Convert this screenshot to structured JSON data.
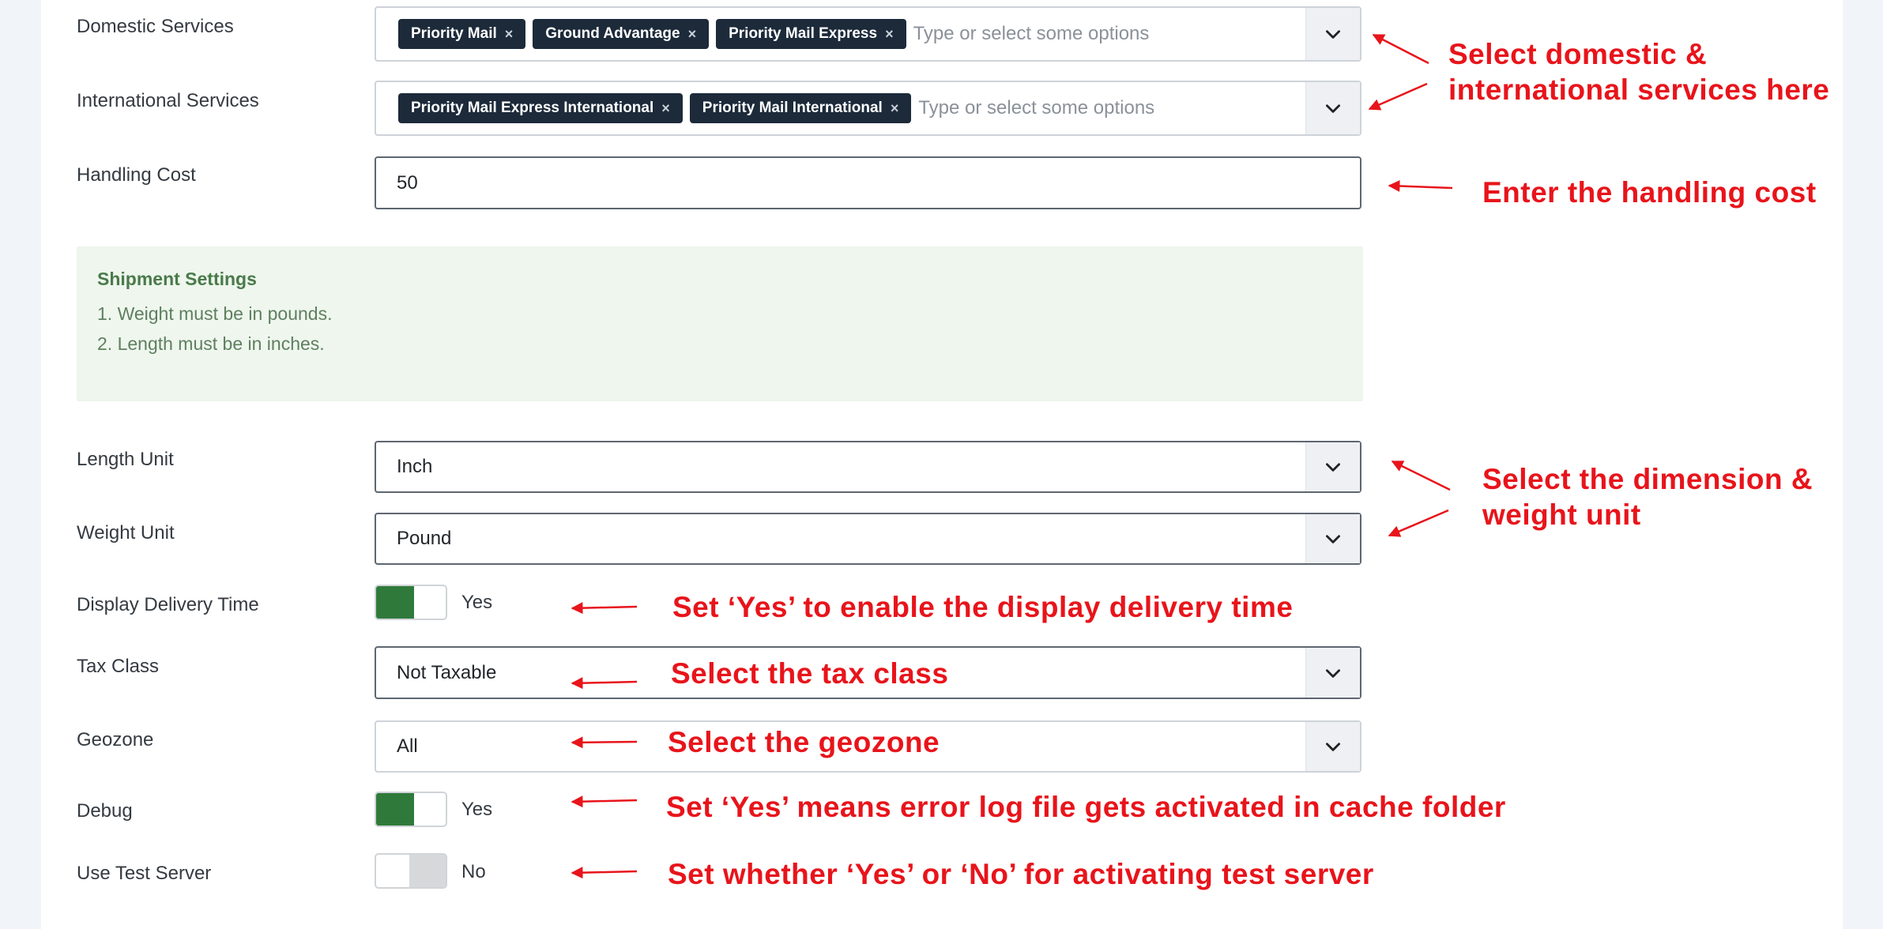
{
  "fields": {
    "domestic": {
      "label": "Domestic Services",
      "chips": [
        "Priority Mail",
        "Ground Advantage",
        "Priority Mail Express"
      ],
      "placeholder": "Type or select some options"
    },
    "international": {
      "label": "International Services",
      "chips": [
        "Priority Mail Express International",
        "Priority Mail International"
      ],
      "placeholder": "Type or select some options"
    },
    "handling_cost": {
      "label": "Handling Cost",
      "value": "50"
    },
    "length_unit": {
      "label": "Length Unit",
      "value": "Inch"
    },
    "weight_unit": {
      "label": "Weight Unit",
      "value": "Pound"
    },
    "display_delivery_time": {
      "label": "Display Delivery Time",
      "state": "Yes"
    },
    "tax_class": {
      "label": "Tax Class",
      "value": "Not Taxable"
    },
    "geozone": {
      "label": "Geozone",
      "value": "All"
    },
    "debug": {
      "label": "Debug",
      "state": "Yes"
    },
    "use_test_server": {
      "label": "Use Test Server",
      "state": "No"
    }
  },
  "notice": {
    "title": "Shipment Settings",
    "lines": [
      "1. Weight must be in pounds.",
      "2. Length must be in inches."
    ]
  },
  "annotations": {
    "services_line1": "Select domestic &",
    "services_line2": "international services here",
    "handling": "Enter the handling cost",
    "units_line1": "Select the dimension &",
    "units_line2": "weight unit",
    "delivery": "Set ‘Yes’ to enable the display delivery time",
    "tax": "Select the tax class",
    "geozone": "Select the geozone",
    "debug": "Set ‘Yes’ means error log file gets activated in cache folder",
    "test_server": "Set whether ‘Yes’ or ‘No’ for activating test server"
  },
  "icons": {
    "dropdown": "chevron-down-icon",
    "chip_remove": "close-icon"
  },
  "colors": {
    "toggle_on": "#2f7a3a",
    "annotation": "#e8141b",
    "chip": "#1c2a3a"
  }
}
